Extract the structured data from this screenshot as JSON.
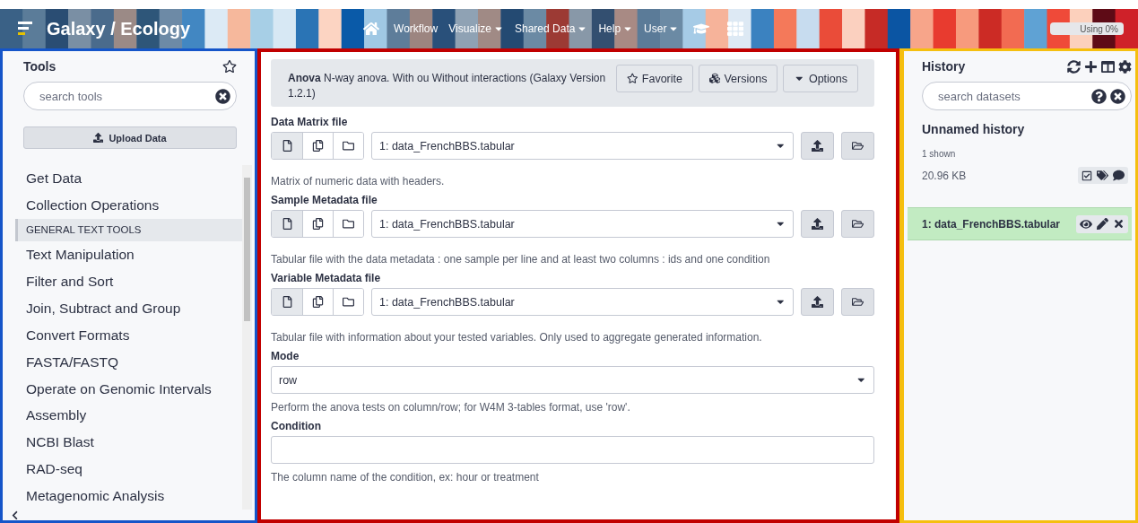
{
  "masthead": {
    "brand": "Galaxy / Ecology",
    "nav": [
      {
        "kind": "icon"
      },
      {
        "kind": "link",
        "label": "Workflow",
        "dropdown": false
      },
      {
        "kind": "link",
        "label": "Visualize",
        "dropdown": true
      },
      {
        "kind": "link",
        "label": "Shared Data",
        "dropdown": true
      },
      {
        "kind": "link",
        "label": "Help",
        "dropdown": true
      },
      {
        "kind": "link",
        "label": "User",
        "dropdown": true
      },
      {
        "kind": "icon"
      },
      {
        "kind": "icon"
      }
    ],
    "quota": {
      "label": "Using 0%"
    }
  },
  "tools": {
    "title": "Tools",
    "search": {
      "placeholder": "search tools"
    },
    "upload": "Upload Data",
    "items": [
      {
        "kind": "category",
        "label": "Get Data",
        "selected": false
      },
      {
        "kind": "category",
        "label": "Collection Operations",
        "selected": false
      },
      {
        "kind": "section",
        "label": "GENERAL TEXT TOOLS",
        "selected": true
      },
      {
        "kind": "category",
        "label": "Text Manipulation",
        "selected": false
      },
      {
        "kind": "category",
        "label": "Filter and Sort",
        "selected": false
      },
      {
        "kind": "category",
        "label": "Join, Subtract and Group",
        "selected": false
      },
      {
        "kind": "category",
        "label": "Convert Formats",
        "selected": false
      },
      {
        "kind": "category",
        "label": "FASTA/FASTQ",
        "selected": false
      },
      {
        "kind": "category",
        "label": "Operate on Genomic Intervals",
        "selected": false
      },
      {
        "kind": "category",
        "label": "Assembly",
        "selected": false
      },
      {
        "kind": "category",
        "label": "NCBI Blast",
        "selected": false
      },
      {
        "kind": "category",
        "label": "RAD-seq",
        "selected": false
      },
      {
        "kind": "category",
        "label": "Metagenomic Analysis",
        "selected": false
      }
    ]
  },
  "tool_form": {
    "description": "**Anova** N-way anova. With ou Without interactions (Galaxy Version 1.2.1)",
    "buttons": [
      {
        "label": "Favorite"
      },
      {
        "label": "Versions"
      },
      {
        "label": "Options"
      }
    ],
    "fields": [
      {
        "kind": "dataset",
        "label": "Data Matrix file",
        "value": "1: data_FrenchBBS.tabular",
        "help": "Matrix of numeric data with headers."
      },
      {
        "kind": "dataset",
        "label": "Sample Metadata file",
        "value": "1: data_FrenchBBS.tabular",
        "help": "Tabular file with the data metadata : one sample per line and at least two columns : ids and one condition"
      },
      {
        "kind": "dataset",
        "label": "Variable Metadata file",
        "value": "1: data_FrenchBBS.tabular",
        "help": "Tabular file with information about your tested variables. Only used to aggregate generated information."
      },
      {
        "kind": "select",
        "label": "Mode",
        "value": "row",
        "help": "Perform the anova tests on column/row; for W4M 3-tables format, use 'row'."
      },
      {
        "kind": "text",
        "label": "Condition",
        "help": "The column name of the condition, ex: hour or treatment"
      }
    ]
  },
  "history": {
    "title": "History",
    "search": {
      "placeholder": "search datasets"
    },
    "name": "Unnamed history",
    "shown": "1 shown",
    "size": "20.96 KB",
    "datasets": [
      {
        "label": "1: data_FrenchBBS.tabular"
      }
    ]
  }
}
